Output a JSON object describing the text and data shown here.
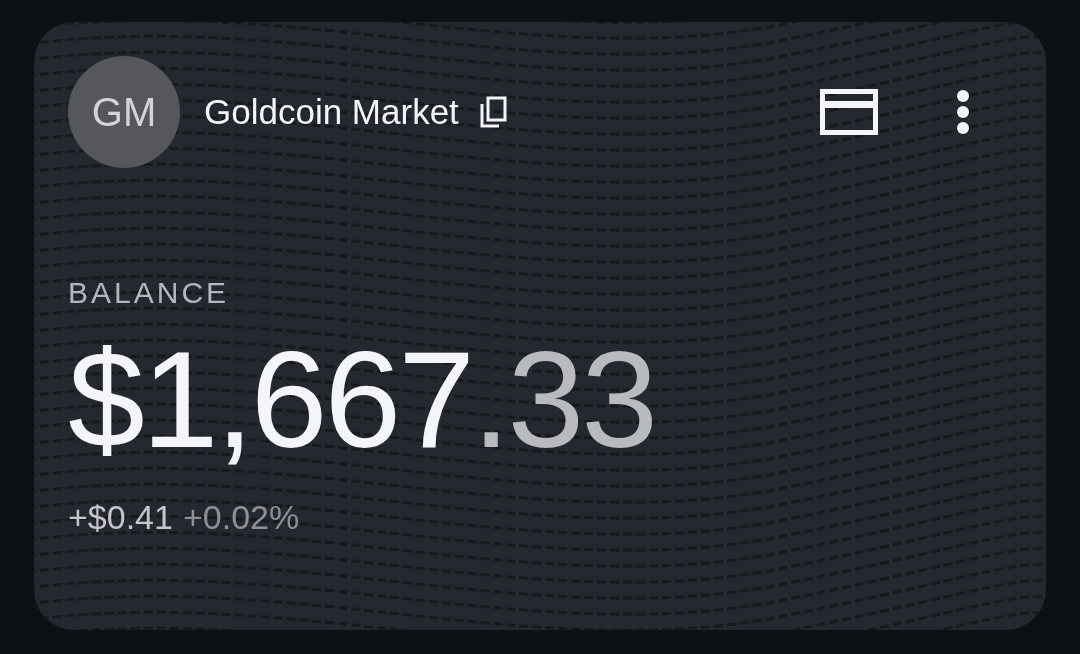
{
  "header": {
    "avatar_initials": "GM",
    "title": "Goldcoin Market"
  },
  "balance": {
    "label": "BALANCE",
    "amount": "$1,667.33",
    "change_amount": "+$0.41",
    "change_percent": "+0.02%"
  }
}
